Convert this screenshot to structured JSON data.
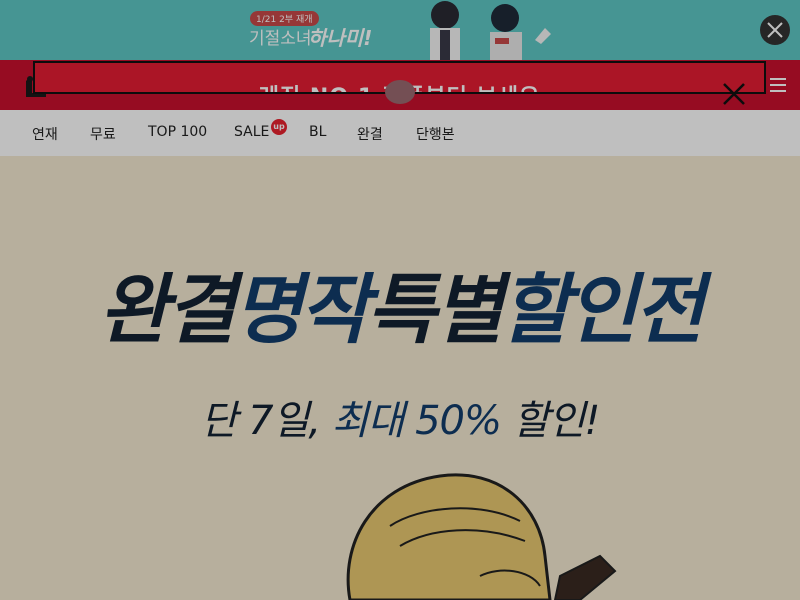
{
  "top_banner": {
    "badge": "1/21 2부 재개",
    "subtitle": "기절소녀",
    "title": "하나미!",
    "background": "#5ec7c4"
  },
  "popup": {
    "text": "레진 NO.1 작품부터 보세요",
    "background": "#e41c33"
  },
  "nav": {
    "items": [
      {
        "label": "연재"
      },
      {
        "label": "무료"
      },
      {
        "label": "TOP 100"
      },
      {
        "label": "SALE"
      },
      {
        "label": "BL"
      },
      {
        "label": "완결"
      },
      {
        "label": "단행본"
      }
    ],
    "sale_badge": "up"
  },
  "hero": {
    "title_part1": "완결",
    "title_part2": "명작",
    "title_part3": "특별",
    "title_part4": "할인전",
    "subtitle_part1": "단 7일,",
    "subtitle_part2": "최대 50%",
    "subtitle_part3": "할인!"
  },
  "colors": {
    "brand_red": "#c8102e",
    "hero_bg": "#f4ead2",
    "title_dark": "#132233",
    "title_blue": "#123d6b"
  }
}
